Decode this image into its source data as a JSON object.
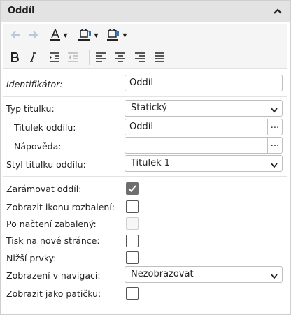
{
  "panel": {
    "title": "Oddíl"
  },
  "fields": {
    "identifikator": {
      "label": "Identifikátor:",
      "value": "Oddíl"
    },
    "typ_titulku": {
      "label": "Typ titulku:",
      "value": "Statický"
    },
    "titulek_oddilu": {
      "label": "Titulek oddílu:",
      "value": "Oddíl",
      "button": "..."
    },
    "napoveda": {
      "label": "Nápověda:",
      "value": "",
      "button": "..."
    },
    "styl_titulku": {
      "label": "Styl titulku oddílu:",
      "value": "Titulek 1"
    },
    "zaramovat": {
      "label": "Zarámovat oddíl:",
      "checked": true
    },
    "ikonu_rozbaleni": {
      "label": "Zobrazit ikonu rozbalení:",
      "checked": false
    },
    "po_nacteni_zabaleny": {
      "label": "Po načtení zabalený:",
      "checked": false,
      "disabled": true
    },
    "tisk_nova_strana": {
      "label": "Tisk na nové stránce:",
      "checked": false
    },
    "nizsi_prvky": {
      "label": "Nižší prvky:",
      "checked": false
    },
    "zobrazeni_navigaci": {
      "label": "Zobrazení v navigaci:",
      "value": "Nezobrazovat"
    },
    "jako_paticku": {
      "label": "Zobrazit jako patičku:",
      "checked": false
    }
  },
  "toolbar_icons": [
    "undo-icon",
    "redo-icon",
    "font-color-icon",
    "highlight-color-icon",
    "fill-color-icon",
    "bold-icon",
    "italic-icon",
    "indent-icon",
    "outdent-icon",
    "align-left-icon",
    "align-center-icon",
    "align-right-icon",
    "justify-icon"
  ],
  "colors": {
    "header_bg": "#e3e3e3",
    "toolbar_bg": "#f5f5f5",
    "checkbox_checked": "#6e6e6e"
  }
}
